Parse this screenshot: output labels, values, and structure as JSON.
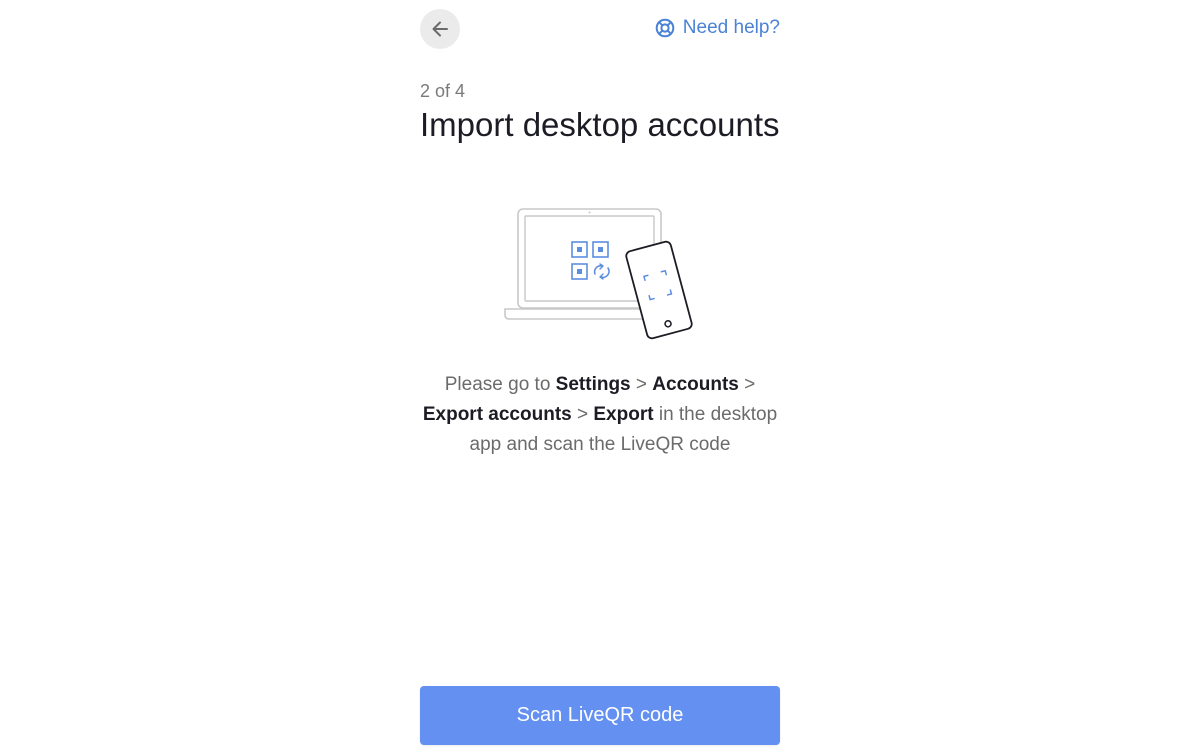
{
  "nav": {
    "back_icon": "arrow-left-icon",
    "help_icon": "lifebuoy-icon",
    "help_label": "Need help?"
  },
  "header": {
    "step": "2 of 4",
    "title": "Import desktop accounts"
  },
  "illustration": {
    "icon": "laptop-phone-qr-illustration"
  },
  "instructions": {
    "part1": "Please go to ",
    "settings": "Settings",
    "sep1": " > ",
    "accounts": "Accounts",
    "sep2": " > ",
    "export_accounts": "Export accounts",
    "sep3": " > ",
    "export": "Export",
    "part2": " in the desktop app and scan the LiveQR code"
  },
  "footer": {
    "scan_label": "Scan LiveQR code"
  },
  "colors": {
    "accent": "#6490f1",
    "link": "#4a82d6",
    "back_bg": "#ebebeb"
  }
}
